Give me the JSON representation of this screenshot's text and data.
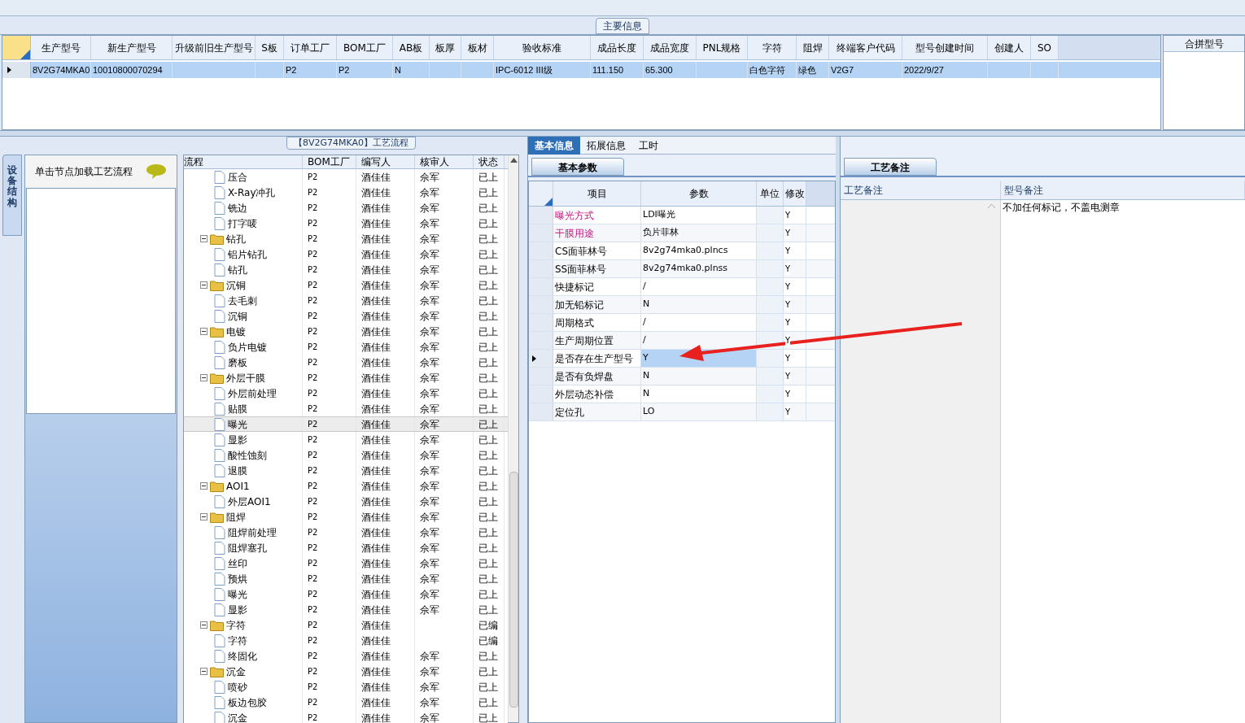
{
  "main_info": {
    "title": "主要信息",
    "columns": [
      "生产型号",
      "新生产型号",
      "升级前旧生产型号",
      "S板",
      "订单工厂",
      "BOM工厂",
      "AB板",
      "板厚",
      "板材",
      "验收标准",
      "成品长度",
      "成品宽度",
      "PNL规格",
      "字符",
      "阻焊",
      "终端客户代码",
      "型号创建时间",
      "创建人",
      "SO"
    ],
    "rows": [
      {
        "selected": true,
        "cells": [
          "8V2G74MKA0",
          "10010800070294",
          null,
          null,
          "P2",
          "P2",
          "N",
          null,
          null,
          "IPC-6012 III级",
          "111.150",
          "65.300",
          null,
          "白色字符",
          "绿色",
          "V2G7",
          "2022/9/27",
          null,
          null
        ]
      }
    ]
  },
  "merge_panel": {
    "column": "合拼型号"
  },
  "side_tab": {
    "label": "设备结构"
  },
  "node_panel": {
    "hint": "单击节点加载工艺流程"
  },
  "flow": {
    "title": "【8V2G74MKA0】工艺流程",
    "columns": [
      "流程",
      "BOM工厂",
      "编写人",
      "核审人",
      "状态"
    ],
    "nodes": [
      {
        "kind": "group",
        "children": [
          {
            "kind": "file",
            "label": "压合",
            "bom": "P2",
            "writer": "酒佳佳",
            "reviewer": "佘军",
            "status": "已上",
            "selected": false
          },
          {
            "kind": "file",
            "label": "X-Ray冲孔",
            "bom": "P2",
            "writer": "酒佳佳",
            "reviewer": "佘军",
            "status": "已上",
            "selected": false
          },
          {
            "kind": "file",
            "label": "铣边",
            "bom": "P2",
            "writer": "酒佳佳",
            "reviewer": "佘军",
            "status": "已上",
            "selected": false
          },
          {
            "kind": "file",
            "label": "打字唛",
            "bom": "P2",
            "writer": "酒佳佳",
            "reviewer": "佘军",
            "status": "已上",
            "selected": false
          }
        ]
      },
      {
        "kind": "folder",
        "label": "钻孔",
        "bom": "P2",
        "writer": "酒佳佳",
        "reviewer": "佘军",
        "status": "已上",
        "selected": false,
        "expanded": true,
        "children": [
          {
            "kind": "file",
            "label": "铝片钻孔",
            "bom": "P2",
            "writer": "酒佳佳",
            "reviewer": "佘军",
            "status": "已上",
            "selected": false
          },
          {
            "kind": "file",
            "label": "钻孔",
            "bom": "P2",
            "writer": "酒佳佳",
            "reviewer": "佘军",
            "status": "已上",
            "selected": false
          }
        ]
      },
      {
        "kind": "folder",
        "label": "沉铜",
        "bom": "P2",
        "writer": "酒佳佳",
        "reviewer": "佘军",
        "status": "已上",
        "selected": false,
        "expanded": true,
        "children": [
          {
            "kind": "file",
            "label": "去毛刺",
            "bom": "P2",
            "writer": "酒佳佳",
            "reviewer": "佘军",
            "status": "已上",
            "selected": false
          },
          {
            "kind": "file",
            "label": "沉铜",
            "bom": "P2",
            "writer": "酒佳佳",
            "reviewer": "佘军",
            "status": "已上",
            "selected": false
          }
        ]
      },
      {
        "kind": "folder",
        "label": "电镀",
        "bom": "P2",
        "writer": "酒佳佳",
        "reviewer": "佘军",
        "status": "已上",
        "selected": false,
        "expanded": true,
        "children": [
          {
            "kind": "file",
            "label": "负片电镀",
            "bom": "P2",
            "writer": "酒佳佳",
            "reviewer": "佘军",
            "status": "已上",
            "selected": false
          },
          {
            "kind": "file",
            "label": "磨板",
            "bom": "P2",
            "writer": "酒佳佳",
            "reviewer": "佘军",
            "status": "已上",
            "selected": false
          }
        ]
      },
      {
        "kind": "folder",
        "label": "外层干膜",
        "bom": "P2",
        "writer": "酒佳佳",
        "reviewer": "佘军",
        "status": "已上",
        "selected": false,
        "expanded": true,
        "children": [
          {
            "kind": "file",
            "label": "外层前处理",
            "bom": "P2",
            "writer": "酒佳佳",
            "reviewer": "佘军",
            "status": "已上",
            "selected": false
          },
          {
            "kind": "file",
            "label": "贴膜",
            "bom": "P2",
            "writer": "酒佳佳",
            "reviewer": "佘军",
            "status": "已上",
            "selected": false
          },
          {
            "kind": "file",
            "label": "曝光",
            "bom": "P2",
            "writer": "酒佳佳",
            "reviewer": "佘军",
            "status": "已上",
            "selected": true
          },
          {
            "kind": "file",
            "label": "显影",
            "bom": "P2",
            "writer": "酒佳佳",
            "reviewer": "佘军",
            "status": "已上",
            "selected": false
          },
          {
            "kind": "file",
            "label": "酸性蚀刻",
            "bom": "P2",
            "writer": "酒佳佳",
            "reviewer": "佘军",
            "status": "已上",
            "selected": false
          },
          {
            "kind": "file",
            "label": "退膜",
            "bom": "P2",
            "writer": "酒佳佳",
            "reviewer": "佘军",
            "status": "已上",
            "selected": false
          }
        ]
      },
      {
        "kind": "folder",
        "label": "AOI1",
        "bom": "P2",
        "writer": "酒佳佳",
        "reviewer": "佘军",
        "status": "已上",
        "selected": false,
        "expanded": true,
        "children": [
          {
            "kind": "file",
            "label": "外层AOI1",
            "bom": "P2",
            "writer": "酒佳佳",
            "reviewer": "佘军",
            "status": "已上",
            "selected": false
          }
        ]
      },
      {
        "kind": "folder",
        "label": "阻焊",
        "bom": "P2",
        "writer": "酒佳佳",
        "reviewer": "佘军",
        "status": "已上",
        "selected": false,
        "expanded": true,
        "children": [
          {
            "kind": "file",
            "label": "阻焊前处理",
            "bom": "P2",
            "writer": "酒佳佳",
            "reviewer": "佘军",
            "status": "已上",
            "selected": false
          },
          {
            "kind": "file",
            "label": "阻焊塞孔",
            "bom": "P2",
            "writer": "酒佳佳",
            "reviewer": "佘军",
            "status": "已上",
            "selected": false
          },
          {
            "kind": "file",
            "label": "丝印",
            "bom": "P2",
            "writer": "酒佳佳",
            "reviewer": "佘军",
            "status": "已上",
            "selected": false
          },
          {
            "kind": "file",
            "label": "预烘",
            "bom": "P2",
            "writer": "酒佳佳",
            "reviewer": "佘军",
            "status": "已上",
            "selected": false
          },
          {
            "kind": "file",
            "label": "曝光",
            "bom": "P2",
            "writer": "酒佳佳",
            "reviewer": "佘军",
            "status": "已上",
            "selected": false
          },
          {
            "kind": "file",
            "label": "显影",
            "bom": "P2",
            "writer": "酒佳佳",
            "reviewer": "佘军",
            "status": "已上",
            "selected": false
          }
        ]
      },
      {
        "kind": "folder",
        "label": "字符",
        "bom": "P2",
        "writer": "酒佳佳",
        "status": "已编",
        "selected": false,
        "expanded": true,
        "children": [
          {
            "kind": "file",
            "label": "字符",
            "bom": "P2",
            "writer": "酒佳佳",
            "status": "已编",
            "selected": false
          },
          {
            "kind": "file",
            "label": "终固化",
            "bom": "P2",
            "writer": "酒佳佳",
            "reviewer": "佘军",
            "status": "已上",
            "selected": false
          }
        ]
      },
      {
        "kind": "folder",
        "label": "沉金",
        "bom": "P2",
        "writer": "酒佳佳",
        "reviewer": "佘军",
        "status": "已上",
        "selected": false,
        "expanded": true,
        "children": [
          {
            "kind": "file",
            "label": "喷砂",
            "bom": "P2",
            "writer": "酒佳佳",
            "reviewer": "佘军",
            "status": "已上",
            "selected": false
          },
          {
            "kind": "file",
            "label": "板边包胶",
            "bom": "P2",
            "writer": "酒佳佳",
            "reviewer": "佘军",
            "status": "已上",
            "selected": false
          },
          {
            "kind": "file",
            "label": "沉金",
            "bom": "P2",
            "writer": "酒佳佳",
            "reviewer": "佘军",
            "status": "已上",
            "selected": false
          }
        ]
      }
    ]
  },
  "detail_tabs": [
    {
      "label": "基本信息",
      "selected": true
    },
    {
      "label": "拓展信息",
      "selected": false
    },
    {
      "label": "工时",
      "selected": false
    }
  ],
  "params": {
    "title": "基本参数",
    "columns": [
      "项目",
      "参数",
      "单位",
      "修改"
    ],
    "rows": [
      {
        "item": "曝光方式",
        "value": "LDI曝光",
        "modify": "Y",
        "highlighted": true,
        "selected": false
      },
      {
        "item": "干膜用途",
        "value": "负片菲林",
        "modify": "Y",
        "highlighted": true,
        "selected": false
      },
      {
        "item": "CS面菲林号",
        "value": "8v2g74mka0.plncs",
        "modify": "Y",
        "highlighted": false,
        "selected": false
      },
      {
        "item": "SS面菲林号",
        "value": "8v2g74mka0.plnss",
        "modify": "Y",
        "highlighted": false,
        "selected": false
      },
      {
        "item": "快捷标记",
        "value": "/",
        "modify": "Y",
        "highlighted": false,
        "selected": false
      },
      {
        "item": "加无铅标记",
        "value": "N",
        "modify": "Y",
        "highlighted": false,
        "selected": false
      },
      {
        "item": "周期格式",
        "value": "/",
        "modify": "Y",
        "highlighted": false,
        "selected": false
      },
      {
        "item": "生产周期位置",
        "value": "/",
        "modify": "Y",
        "highlighted": false,
        "selected": false
      },
      {
        "item": "是否存在生产型号",
        "value": "Y",
        "modify": "Y",
        "highlighted": false,
        "selected": true
      },
      {
        "item": "是否有负焊盘",
        "value": "N",
        "modify": "Y",
        "highlighted": false,
        "selected": false
      },
      {
        "item": "外层动态补偿",
        "value": "N",
        "modify": "Y",
        "highlighted": false,
        "selected": false
      },
      {
        "item": "定位孔",
        "value": "LO",
        "modify": "Y",
        "highlighted": false,
        "selected": false
      }
    ]
  },
  "notes": {
    "title": "工艺备注",
    "columns": [
      "工艺备注",
      "型号备注"
    ],
    "model_note": "不加任何标记，不盖电测章"
  }
}
